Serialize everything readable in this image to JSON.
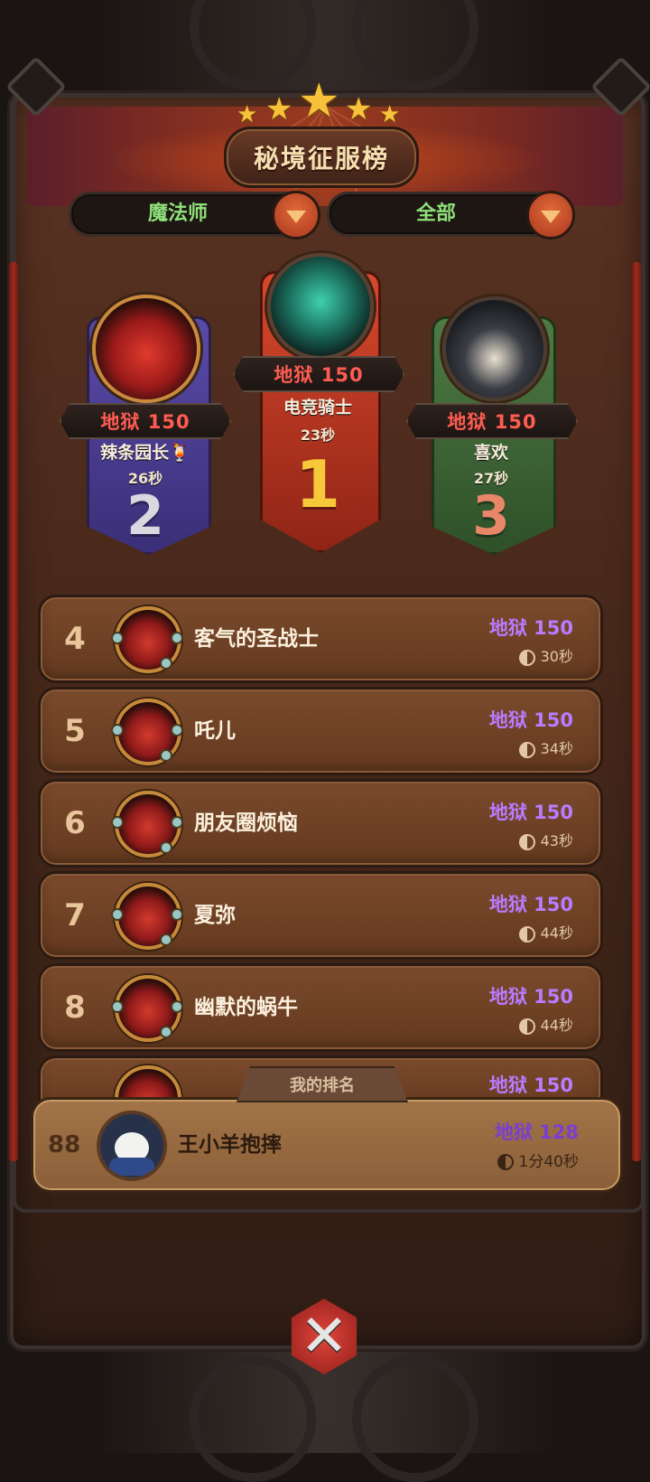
{
  "title": "秘境征服榜",
  "filters": {
    "class": "魔法师",
    "scope": "全部"
  },
  "podium": [
    {
      "rank": "1",
      "score": "地狱 150",
      "name": "电竞骑士",
      "time": "23秒",
      "color": "#c23a22"
    },
    {
      "rank": "2",
      "score": "地狱 150",
      "name": "辣条园长🍹",
      "time": "26秒",
      "color": "#4a3a8a"
    },
    {
      "rank": "3",
      "score": "地狱 150",
      "name": "喜欢",
      "time": "27秒",
      "color": "#3f6a3a"
    }
  ],
  "list": [
    {
      "rank": "4",
      "name": "客气的圣战士",
      "score": "地狱 150",
      "time": "30秒"
    },
    {
      "rank": "5",
      "name": "吒儿",
      "score": "地狱 150",
      "time": "34秒"
    },
    {
      "rank": "6",
      "name": "朋友圈烦恼",
      "score": "地狱 150",
      "time": "43秒"
    },
    {
      "rank": "7",
      "name": "夏弥",
      "score": "地狱 150",
      "time": "44秒"
    },
    {
      "rank": "8",
      "name": "幽默的蜗牛",
      "score": "地狱 150",
      "time": "44秒"
    }
  ],
  "partial_row": {
    "score": "地狱 150"
  },
  "my_rank": {
    "label": "我的排名",
    "rank": "88",
    "name": "王小羊抱摔",
    "score": "地狱 128",
    "time": "1分40秒"
  },
  "colors": {
    "hell_score": "#b97cff",
    "podium_score": "#ff5c52",
    "filter_text": "#8fe07a"
  }
}
